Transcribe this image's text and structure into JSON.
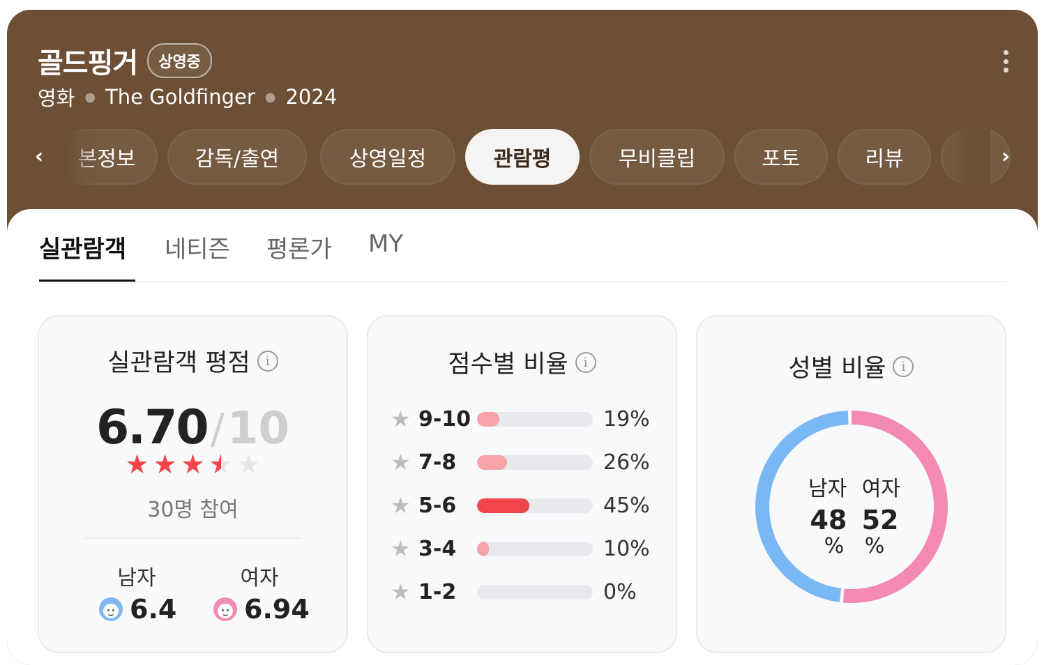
{
  "header": {
    "title": "골드핑거",
    "status_badge": "상영중",
    "type": "영화",
    "original_title": "The Goldfinger",
    "year": "2024"
  },
  "nav_tabs": [
    "본정보",
    "감독/출연",
    "상영일정",
    "관람평",
    "무비클립",
    "포토",
    "리뷰",
    ""
  ],
  "active_tab": "관람평",
  "sub_tabs": [
    "실관람객",
    "네티즌",
    "평론가",
    "MY"
  ],
  "active_sub_tab": "실관람객",
  "rating_card": {
    "title": "실관람객 평점",
    "score": "6.70",
    "slash": "/",
    "max": "10",
    "stars_filled": 3.5,
    "stars_total": 5,
    "participants": "30명 참여",
    "male_label": "남자",
    "female_label": "여자",
    "male_score": "6.4",
    "female_score": "6.94"
  },
  "distribution_card": {
    "title": "점수별 비율",
    "rows": [
      {
        "label": "9-10",
        "percent": "19%",
        "value": 19,
        "color": "#f5a4a7"
      },
      {
        "label": "7-8",
        "percent": "26%",
        "value": 26,
        "color": "#f5a4a7"
      },
      {
        "label": "5-6",
        "percent": "45%",
        "value": 45,
        "color": "#f2444b"
      },
      {
        "label": "3-4",
        "percent": "10%",
        "value": 10,
        "color": "#f5a4a7"
      },
      {
        "label": "1-2",
        "percent": "0%",
        "value": 0,
        "color": "#f5a4a7"
      }
    ]
  },
  "gender_card": {
    "title": "성별 비율",
    "male_label": "남자",
    "female_label": "여자",
    "male_percent": "48",
    "female_percent": "52",
    "percent_sign": "%",
    "male_value": 48,
    "female_value": 52,
    "male_color": "#7ab8f5",
    "female_color": "#f28ab4"
  },
  "colors": {
    "header_background": "#6c4f35",
    "accent_red": "#f2444b"
  }
}
